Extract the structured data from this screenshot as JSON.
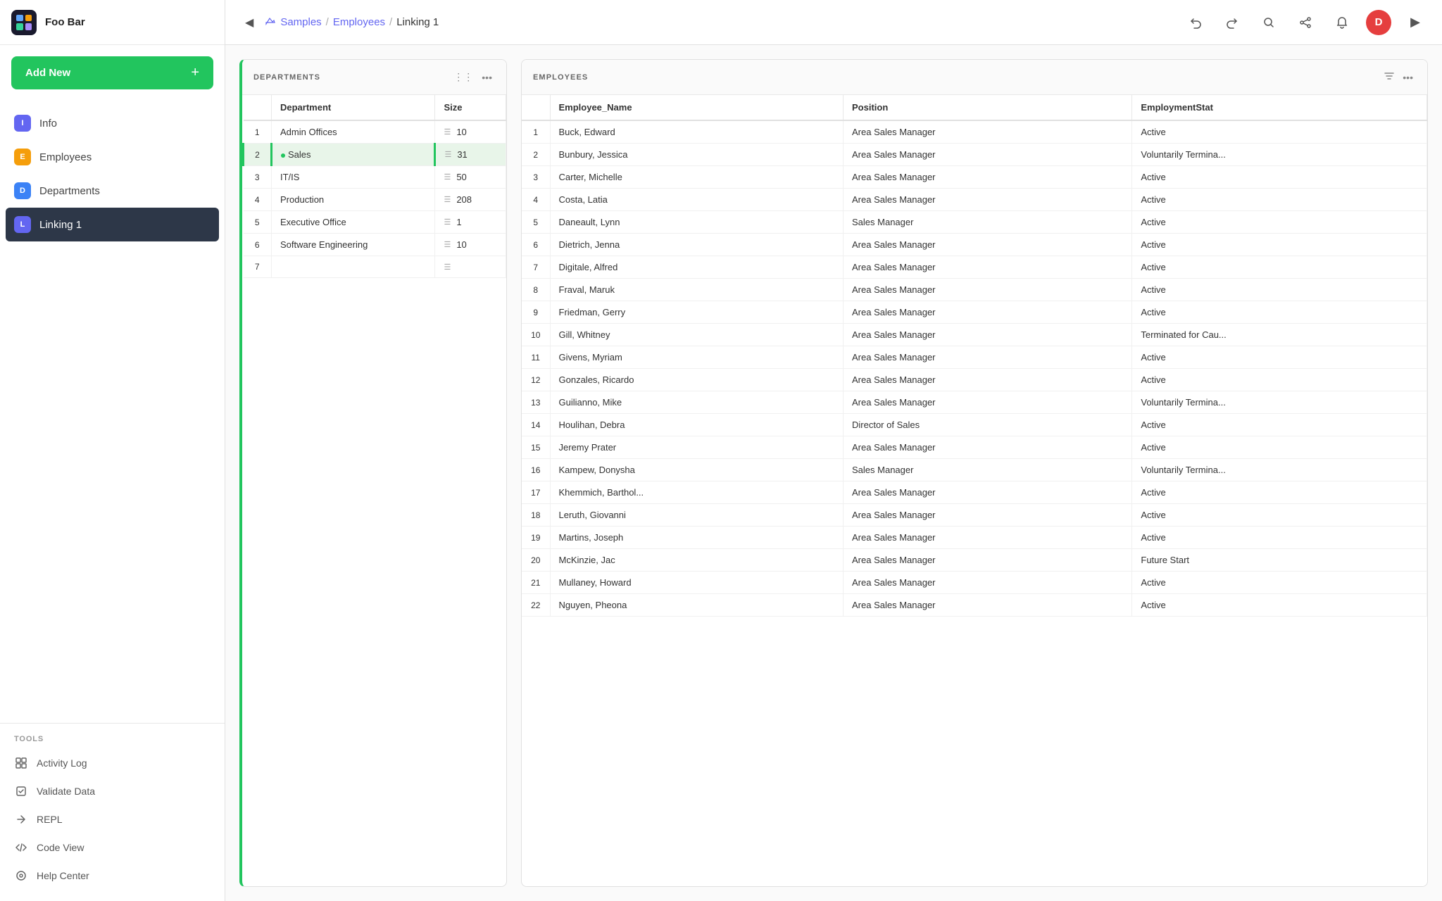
{
  "brand": "Foo Bar",
  "sidebar": {
    "add_new_label": "Add New",
    "nav_items": [
      {
        "id": "info",
        "label": "Info",
        "icon": "I",
        "icon_class": "i-icon",
        "active": false
      },
      {
        "id": "employees",
        "label": "Employees",
        "icon": "E",
        "icon_class": "e-icon",
        "active": false
      },
      {
        "id": "departments",
        "label": "Departments",
        "icon": "D",
        "icon_class": "d-icon",
        "active": false
      },
      {
        "id": "linking1",
        "label": "Linking 1",
        "icon": "L",
        "icon_class": "l-icon",
        "active": true
      }
    ],
    "tools_label": "TOOLS",
    "tools": [
      {
        "id": "activity-log",
        "label": "Activity Log",
        "icon": "⊞"
      },
      {
        "id": "validate-data",
        "label": "Validate Data",
        "icon": "⧇"
      },
      {
        "id": "repl",
        "label": "REPL",
        "icon": "✕"
      },
      {
        "id": "code-view",
        "label": "Code View",
        "icon": "</>"
      },
      {
        "id": "help-center",
        "label": "Help Center",
        "icon": "◎"
      }
    ]
  },
  "topbar": {
    "breadcrumb": {
      "samples": "Samples",
      "employees": "Employees",
      "current": "Linking 1"
    },
    "user_initial": "D"
  },
  "departments_table": {
    "title": "DEPARTMENTS",
    "columns": [
      "Department",
      "Size"
    ],
    "rows": [
      {
        "num": 1,
        "department": "Admin Offices",
        "size": 10,
        "selected": false
      },
      {
        "num": 2,
        "department": "Sales",
        "size": 31,
        "selected": true
      },
      {
        "num": 3,
        "department": "IT/IS",
        "size": 50,
        "selected": false
      },
      {
        "num": 4,
        "department": "Production",
        "size": 208,
        "selected": false
      },
      {
        "num": 5,
        "department": "Executive Office",
        "size": 1,
        "selected": false
      },
      {
        "num": 6,
        "department": "Software Engineering",
        "size": 10,
        "selected": false
      },
      {
        "num": 7,
        "department": "",
        "size": null,
        "selected": false
      }
    ]
  },
  "employees_table": {
    "title": "EMPLOYEES",
    "columns": [
      "Employee_Name",
      "Position",
      "EmploymentStat"
    ],
    "rows": [
      {
        "num": 1,
        "name": "Buck, Edward",
        "position": "Area Sales Manager",
        "status": "Active"
      },
      {
        "num": 2,
        "name": "Bunbury, Jessica",
        "position": "Area Sales Manager",
        "status": "Voluntarily Termina..."
      },
      {
        "num": 3,
        "name": "Carter, Michelle",
        "position": "Area Sales Manager",
        "status": "Active"
      },
      {
        "num": 4,
        "name": "Costa, Latia",
        "position": "Area Sales Manager",
        "status": "Active"
      },
      {
        "num": 5,
        "name": "Daneault, Lynn",
        "position": "Sales Manager",
        "status": "Active"
      },
      {
        "num": 6,
        "name": "Dietrich, Jenna",
        "position": "Area Sales Manager",
        "status": "Active"
      },
      {
        "num": 7,
        "name": "Digitale, Alfred",
        "position": "Area Sales Manager",
        "status": "Active"
      },
      {
        "num": 8,
        "name": "Fraval, Maruk",
        "position": "Area Sales Manager",
        "status": "Active"
      },
      {
        "num": 9,
        "name": "Friedman, Gerry",
        "position": "Area Sales Manager",
        "status": "Active"
      },
      {
        "num": 10,
        "name": "Gill, Whitney",
        "position": "Area Sales Manager",
        "status": "Terminated for Cau..."
      },
      {
        "num": 11,
        "name": "Givens, Myriam",
        "position": "Area Sales Manager",
        "status": "Active"
      },
      {
        "num": 12,
        "name": "Gonzales, Ricardo",
        "position": "Area Sales Manager",
        "status": "Active"
      },
      {
        "num": 13,
        "name": "Guilianno, Mike",
        "position": "Area Sales Manager",
        "status": "Voluntarily Termina..."
      },
      {
        "num": 14,
        "name": "Houlihan, Debra",
        "position": "Director of Sales",
        "status": "Active"
      },
      {
        "num": 15,
        "name": "Jeremy Prater",
        "position": "Area Sales Manager",
        "status": "Active"
      },
      {
        "num": 16,
        "name": "Kampew, Donysha",
        "position": "Sales Manager",
        "status": "Voluntarily Termina..."
      },
      {
        "num": 17,
        "name": "Khemmich, Barthol...",
        "position": "Area Sales Manager",
        "status": "Active"
      },
      {
        "num": 18,
        "name": "Leruth, Giovanni",
        "position": "Area Sales Manager",
        "status": "Active"
      },
      {
        "num": 19,
        "name": "Martins, Joseph",
        "position": "Area Sales Manager",
        "status": "Active"
      },
      {
        "num": 20,
        "name": "McKinzie, Jac",
        "position": "Area Sales Manager",
        "status": "Future Start"
      },
      {
        "num": 21,
        "name": "Mullaney, Howard",
        "position": "Area Sales Manager",
        "status": "Active"
      },
      {
        "num": 22,
        "name": "Nguyen, Pheona",
        "position": "Area Sales Manager",
        "status": "Active"
      }
    ]
  }
}
